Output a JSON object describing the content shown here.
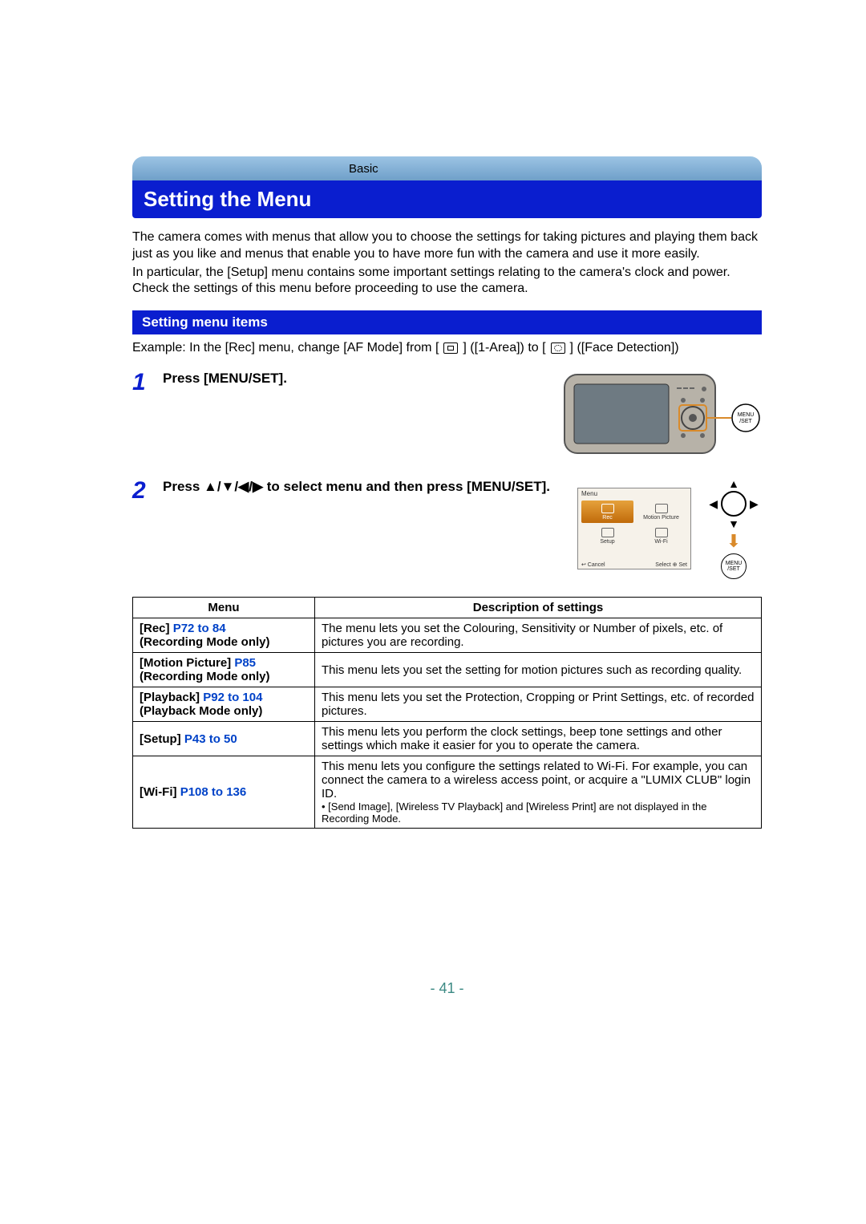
{
  "header": {
    "breadcrumb": "Basic",
    "title": "Setting the Menu"
  },
  "intro": {
    "p1": "The camera comes with menus that allow you to choose the settings for taking pictures and playing them back just as you like and menus that enable you to have more fun with the camera and use it more easily.",
    "p2": "In particular, the [Setup] menu contains some important settings relating to the camera's clock and power. Check the settings of this menu before proceeding to use the camera."
  },
  "section": {
    "title": "Setting menu items",
    "example_prefix": "Example: In the [Rec] menu, change [AF Mode] from [",
    "example_mid1": "] ([1-Area]) to [",
    "example_mid2": "] ([Face Detection])"
  },
  "steps": {
    "s1": {
      "num": "1",
      "text": "Press [MENU/SET]."
    },
    "s2": {
      "num": "2",
      "text_a": "Press ",
      "text_b": " to select menu and then press [MENU/SET].",
      "arrows": "▲/▼/◀/▶"
    }
  },
  "menuset_label": "MENU /SET",
  "menu_preview": {
    "header": "Menu",
    "cells": [
      "Rec",
      "Motion Picture",
      "Setup",
      "Wi-Fi"
    ],
    "footer_left": "↩ Cancel",
    "footer_right": "Select ⊕ Set"
  },
  "table": {
    "col1": "Menu",
    "col2": "Description of settings",
    "rows": [
      {
        "menu": "[Rec]",
        "pages": "P72 to 84",
        "mode": "(Recording Mode only)",
        "desc": "The menu lets you set the Colouring, Sensitivity or Number of pixels, etc. of pictures you are recording."
      },
      {
        "menu": "[Motion Picture]",
        "pages": "P85",
        "mode": "(Recording Mode only)",
        "desc": "This menu lets you set the setting for motion pictures such as recording quality."
      },
      {
        "menu": "[Playback]",
        "pages": "P92 to 104",
        "mode": "(Playback Mode only)",
        "desc": "This menu lets you set the Protection, Cropping or Print Settings, etc. of recorded pictures."
      },
      {
        "menu": "[Setup]",
        "pages": "P43 to 50",
        "mode": "",
        "desc": "This menu lets you perform the clock settings, beep tone settings and other settings which make it easier for you to operate the camera."
      },
      {
        "menu": "[Wi-Fi]",
        "pages": "P108 to 136",
        "mode": "",
        "desc": "This menu lets you configure the settings related to Wi-Fi. For example, you can connect the camera to a wireless access point, or acquire a \"LUMIX CLUB\" login ID.",
        "note": "• [Send Image], [Wireless TV Playback] and [Wireless Print] are not displayed in the Recording Mode."
      }
    ]
  },
  "page_number": "- 41 -"
}
